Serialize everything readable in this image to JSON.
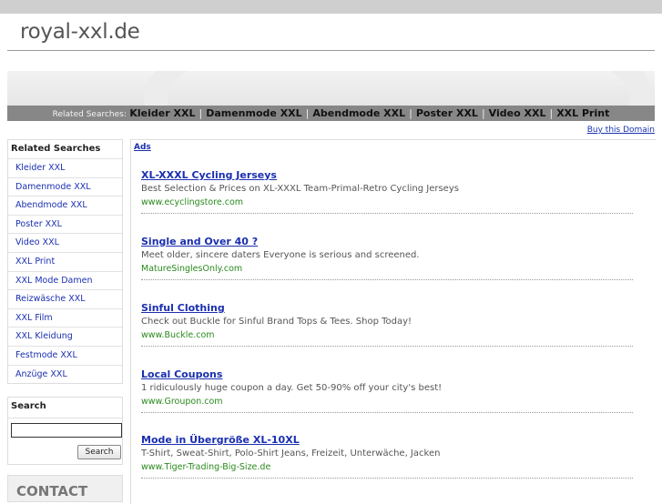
{
  "site": {
    "title": "royal-xxl.de"
  },
  "related_bar": {
    "label": "Related Searches:",
    "links": [
      "Kleider XXL",
      "Damenmode XXL",
      "Abendmode XXL",
      "Poster XXL",
      "Video XXL",
      "XXL Print"
    ],
    "separator": "|"
  },
  "buy_domain": "Buy this Domain",
  "sidebar": {
    "heading": "Related Searches",
    "items": [
      "Kleider XXL",
      "Damenmode XXL",
      "Abendmode XXL",
      "Poster XXL",
      "Video XXL",
      "XXL Print",
      "XXL Mode Damen",
      "Reizwäsche XXL",
      "XXL Film",
      "XXL Kleidung",
      "Festmode XXL",
      "Anzüge XXL"
    ],
    "search_heading": "Search",
    "search_input_value": "",
    "search_button": "Search",
    "contact": "CONTACT"
  },
  "ads": {
    "label": "Ads",
    "items": [
      {
        "title": "XL-XXXL Cycling Jerseys",
        "desc": "Best Selection & Prices on XL-XXXL Team-Primal-Retro Cycling Jerseys",
        "url": "www.ecyclingstore.com"
      },
      {
        "title": "Single and Over 40 ?",
        "desc": "Meet older, sincere daters Everyone is serious and screened.",
        "url": "MatureSinglesOnly.com"
      },
      {
        "title": "Sinful Clothing",
        "desc": "Check out Buckle for Sinful Brand Tops & Tees. Shop Today!",
        "url": "www.Buckle.com"
      },
      {
        "title": "Local Coupons",
        "desc": "1 ridiculously huge coupon a day. Get 50-90% off your city's best!",
        "url": "www.Groupon.com"
      },
      {
        "title": "Mode in Übergröße XL-10XL",
        "desc": "T-Shirt, Sweat-Shirt, Polo-Shirt Jeans, Freizeit, Unterwäche, Jacken",
        "url": "www.Tiger-Trading-Big-Size.de"
      }
    ]
  },
  "colors": {
    "link": "#1a2fb0",
    "url_green": "#2a8a1d",
    "bar_gray": "#878787"
  }
}
